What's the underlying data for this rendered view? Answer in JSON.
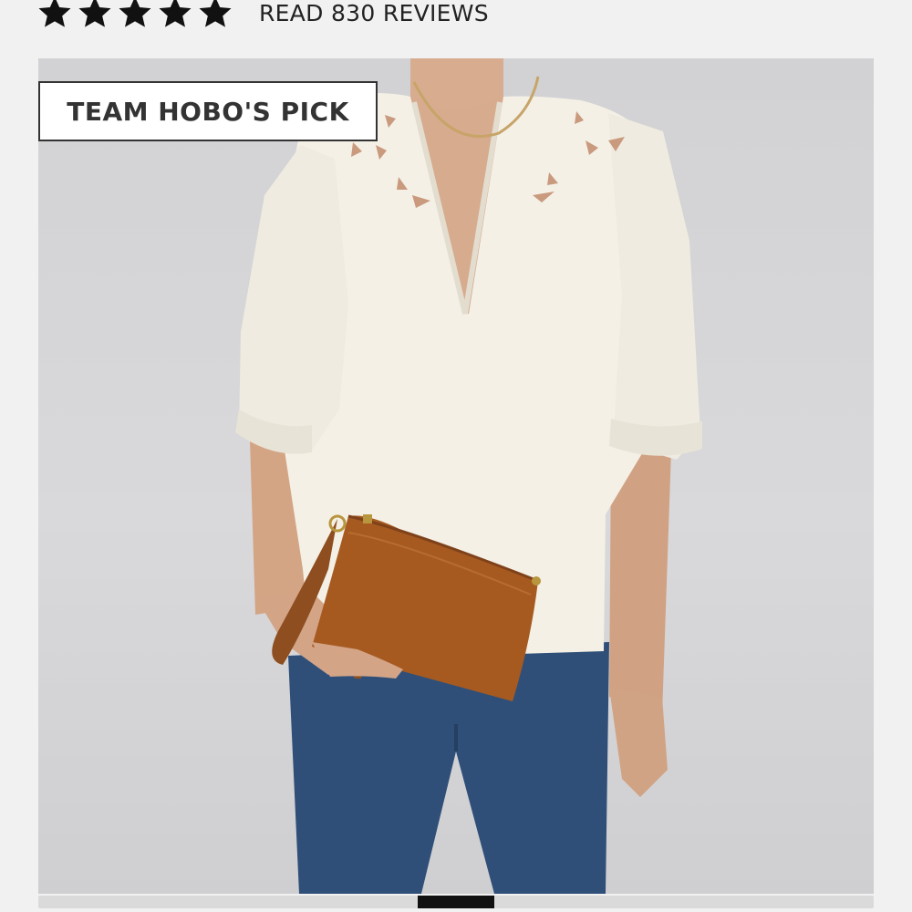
{
  "rating": {
    "stars": 5,
    "star_icon": "star-icon",
    "star_color": "#111111",
    "reviews_label": "READ 830 REVIEWS"
  },
  "product": {
    "badge": "TEAM HOBO'S PICK",
    "photo_icon": "product-photo",
    "bag_color": "#a65a20",
    "top_color": "#f4f0e6",
    "jeans_color": "#2f4f79"
  },
  "carousel": {
    "slide_count": 11,
    "active_index": 5
  }
}
